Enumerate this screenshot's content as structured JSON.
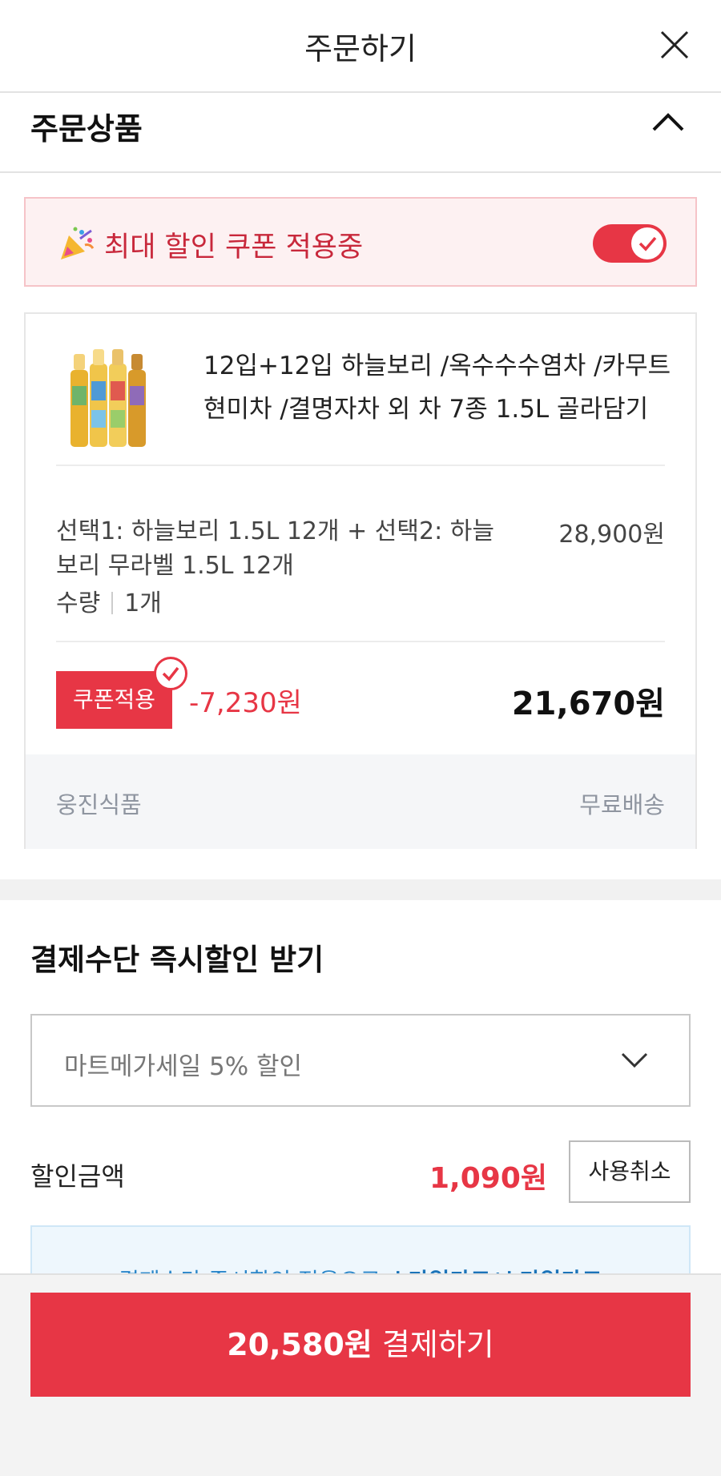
{
  "header": {
    "title": "주문하기",
    "close_icon": "close-icon"
  },
  "order_section": {
    "title": "주문상품",
    "collapse_icon": "chevron-up-icon"
  },
  "coupon_banner": {
    "text": "최대 할인 쿠폰 적용중",
    "toggle_on": true,
    "icon": "party-popper-icon"
  },
  "product": {
    "name": "12입+12입 하늘보리 /옥수수수염차 /카무트현미차 /결명자차 외 차 7종 1.5L 골라담기",
    "option": "선택1: 하늘보리 1.5L 12개 + 선택2: 하늘보리 무라벨 1.5L 12개",
    "option_price": "28,900원",
    "qty_label": "수량",
    "qty_value": "1개",
    "coupon_chip": "쿠폰적용",
    "discount": "-7,230원",
    "final_price": "21,670원",
    "seller": "웅진식품",
    "shipping": "무료배송"
  },
  "payment": {
    "title": "결제수단 즉시할인 받기",
    "select_value": "마트메가세일 5% 할인",
    "discount_label": "할인금액",
    "discount_value": "1,090원",
    "cancel_label": "사용취소",
    "info_prefix": "결제수단 즉시할인 적용으로 ",
    "info_bold": "스마일카드/스마일카드"
  },
  "pay_button": {
    "amount": "20,580원",
    "label": " 결제하기"
  },
  "colors": {
    "accent": "#e73645",
    "info": "#2a86c9"
  }
}
